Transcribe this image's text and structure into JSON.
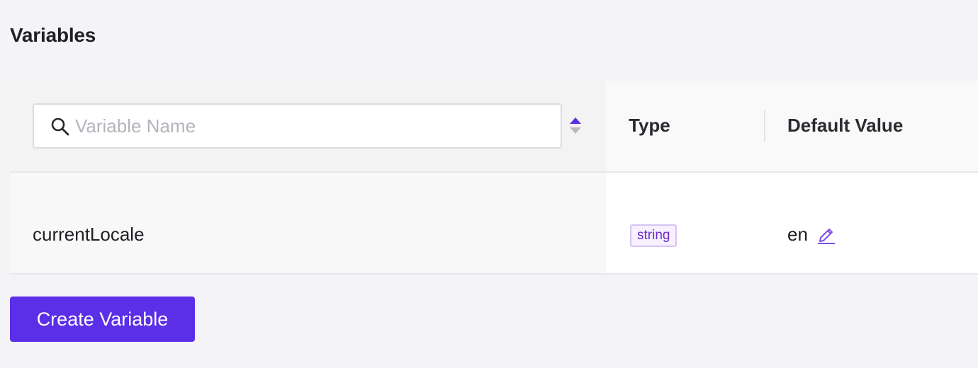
{
  "page": {
    "title": "Variables"
  },
  "search": {
    "placeholder": "Variable Name",
    "value": ""
  },
  "columns": {
    "type": "Type",
    "default_value": "Default Value"
  },
  "rows": [
    {
      "name": "currentLocale",
      "type": "string",
      "default_value": "en"
    }
  ],
  "actions": {
    "create_label": "Create Variable"
  },
  "icons": {
    "search": "search-icon",
    "sort": "sort-arrows-icon",
    "edit": "pencil-edit-icon"
  },
  "colors": {
    "accent": "#5b2ee8",
    "badge_text": "#6b2ac9",
    "badge_bg": "#f6f0ff"
  }
}
